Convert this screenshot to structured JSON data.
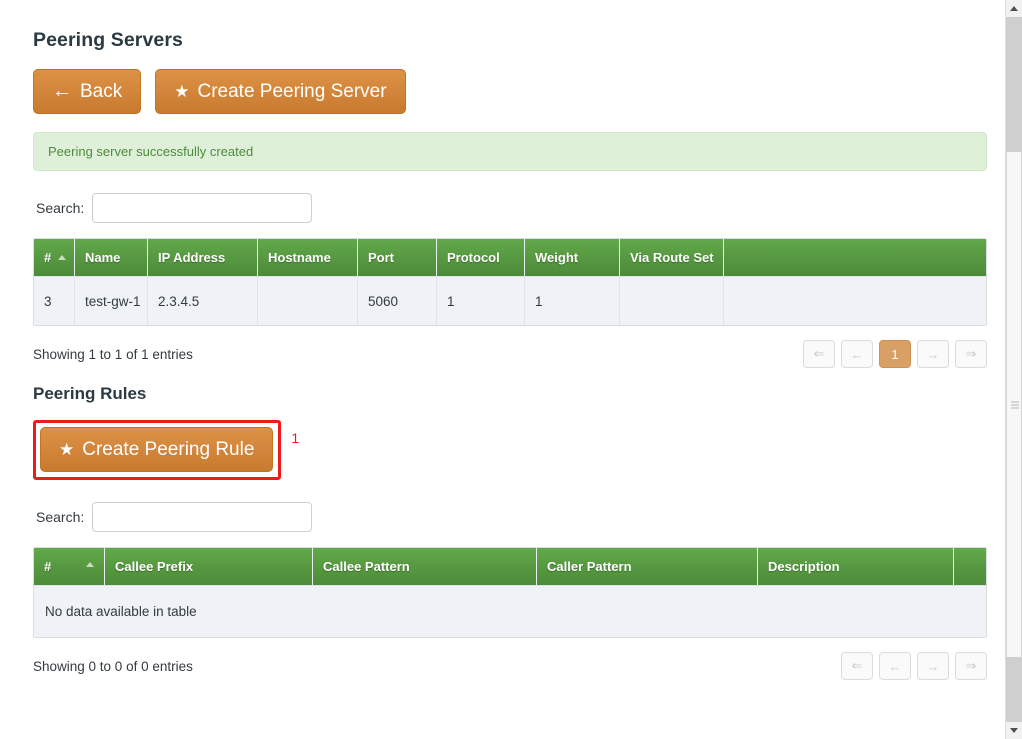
{
  "page": {
    "title": "Peering Servers"
  },
  "toolbar": {
    "back_label": "Back",
    "back_icon": "arrow-left-icon",
    "create_server_label": "Create Peering Server",
    "create_server_icon": "star-icon"
  },
  "alert": {
    "message": "Peering server successfully created",
    "bg_color": "#dff0d8",
    "text_color": "#4f8a3f"
  },
  "servers_table": {
    "search_label": "Search:",
    "search_value": "",
    "search_placeholder": "",
    "columns": [
      "#",
      "Name",
      "IP Address",
      "Hostname",
      "Port",
      "Protocol",
      "Weight",
      "Via Route Set",
      ""
    ],
    "sorted_column": "#",
    "sort_direction": "asc",
    "rows": [
      {
        "num": "3",
        "name": "test-gw-1",
        "ip_address": "2.3.4.5",
        "hostname": "",
        "port": "5060",
        "protocol": "1",
        "weight": "1",
        "via_route_set": "",
        "actions": ""
      }
    ],
    "info": "Showing 1 to 1 of 1 entries",
    "pager": [
      {
        "label": "⇐",
        "name": "first",
        "state": "disabled"
      },
      {
        "label": "←",
        "name": "previous",
        "state": "disabled"
      },
      {
        "label": "1",
        "name": "page-1",
        "state": "active"
      },
      {
        "label": "→",
        "name": "next",
        "state": "disabled"
      },
      {
        "label": "⇒",
        "name": "last",
        "state": "disabled"
      }
    ]
  },
  "rules_section": {
    "title": "Peering Rules",
    "create_rule_label": "Create Peering Rule",
    "create_rule_icon": "star-icon",
    "annotation_number": "1",
    "annotation_color": "#ef1b1b"
  },
  "rules_table": {
    "search_label": "Search:",
    "search_value": "",
    "search_placeholder": "",
    "columns": [
      "#",
      "Callee Prefix",
      "Callee Pattern",
      "Caller Pattern",
      "Description",
      ""
    ],
    "sorted_column": "#",
    "sort_direction": "asc",
    "empty_message": "No data available in table",
    "info": "Showing 0 to 0 of 0 entries",
    "pager": [
      {
        "label": "⇐",
        "name": "first",
        "state": "disabled"
      },
      {
        "label": "←",
        "name": "previous",
        "state": "disabled"
      },
      {
        "label": "→",
        "name": "next",
        "state": "disabled"
      },
      {
        "label": "⇒",
        "name": "last",
        "state": "disabled"
      }
    ]
  },
  "theme": {
    "primary_orange": "#d2853a",
    "table_header_green": "#559640",
    "active_page_orange": "#d9a066"
  }
}
